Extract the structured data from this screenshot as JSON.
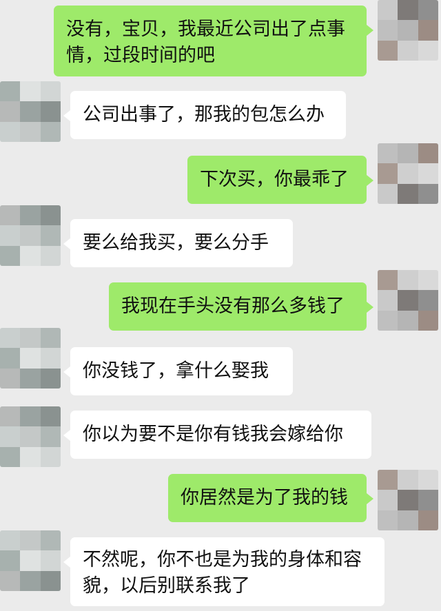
{
  "messages": [
    {
      "side": "me",
      "text": "没有，宝贝，我最近公司出了点事情，过段时间的吧"
    },
    {
      "side": "them",
      "text": "公司出事了，那我的包怎么办"
    },
    {
      "side": "me",
      "text": "下次买，你最乖了"
    },
    {
      "side": "them",
      "text": "要么给我买，要么分手"
    },
    {
      "side": "me",
      "text": "我现在手头没有那么多钱了"
    },
    {
      "side": "them",
      "text": "你没钱了，拿什么娶我"
    },
    {
      "side": "them",
      "text": "你以为要不是你有钱我会嫁给你"
    },
    {
      "side": "me",
      "text": "你居然是为了我的钱"
    },
    {
      "side": "them",
      "text": "不然呢，你不也是为我的身体和容貌，以后别联系我了"
    }
  ],
  "colors": {
    "background": "#ebebeb",
    "me_bubble": "#9eea6a",
    "them_bubble": "#ffffff"
  },
  "avatars": {
    "me": "mosaic-blurred-avatar",
    "them": "mosaic-blurred-avatar"
  }
}
